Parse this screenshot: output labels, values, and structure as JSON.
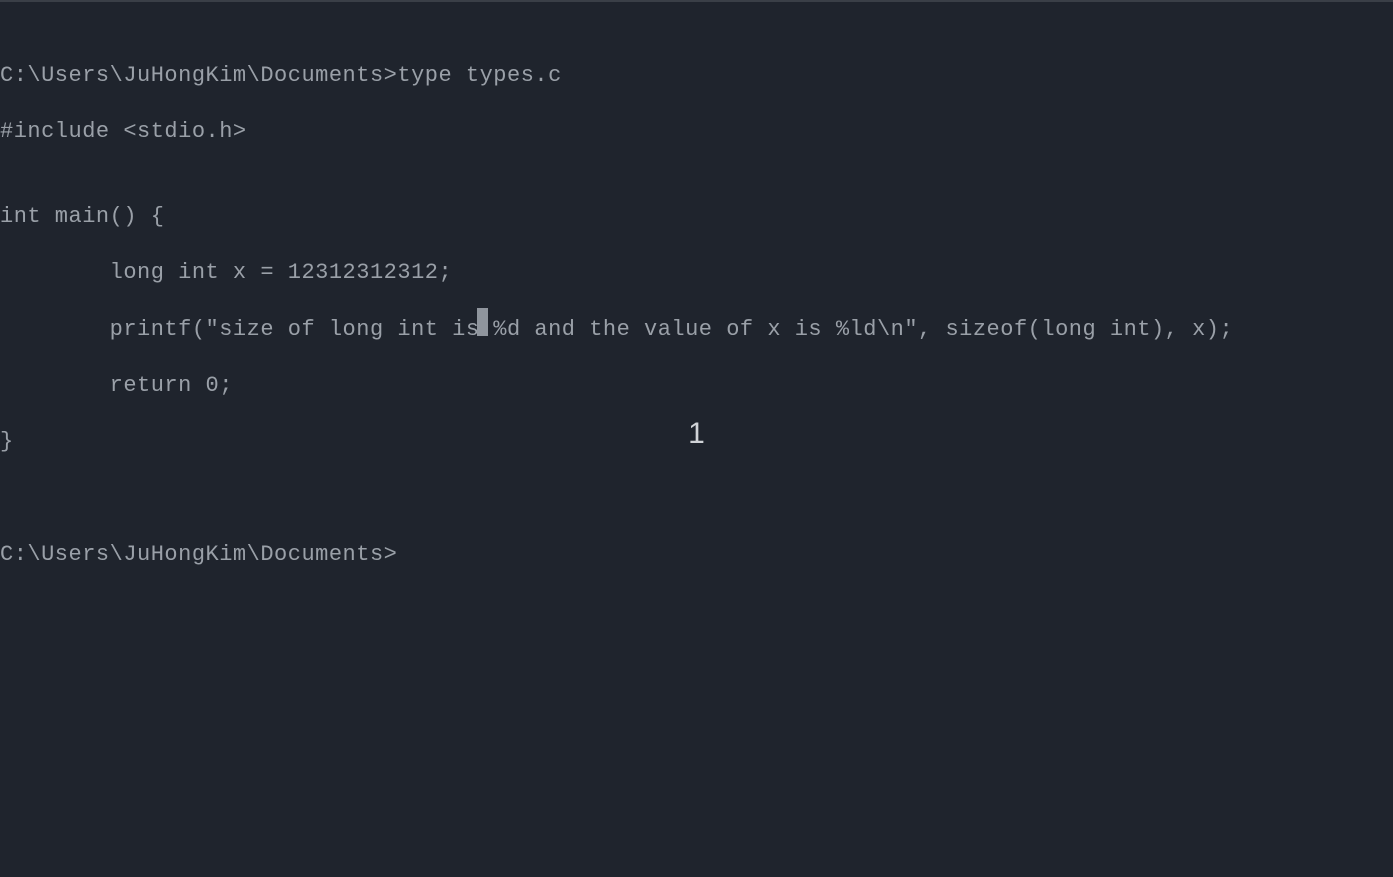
{
  "terminal": {
    "prompt1": "C:\\Users\\JuHongKim\\Documents>",
    "command1": "type types.c",
    "output": {
      "line1": "#include <stdio.h>",
      "line2": "",
      "line3": "int main() {",
      "line4": "        long int x = 12312312312;",
      "line5": "        printf(\"size of long int is %d and the value of x is %ld\\n\", sizeof(long int), x);",
      "line6": "        return 0;",
      "line7": "}"
    },
    "prompt2": "C:\\Users\\JuHongKim\\Documents>"
  },
  "overlay": {
    "number": "1"
  }
}
